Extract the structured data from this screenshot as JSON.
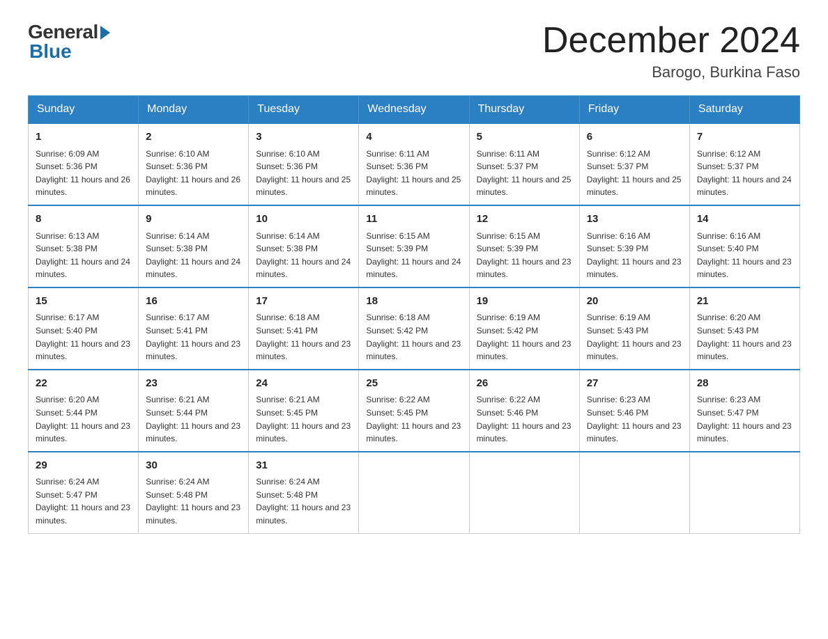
{
  "header": {
    "logo_general": "General",
    "logo_blue": "Blue",
    "title": "December 2024",
    "subtitle": "Barogo, Burkina Faso"
  },
  "days_of_week": [
    "Sunday",
    "Monday",
    "Tuesday",
    "Wednesday",
    "Thursday",
    "Friday",
    "Saturday"
  ],
  "weeks": [
    [
      {
        "day": "1",
        "sunrise": "6:09 AM",
        "sunset": "5:36 PM",
        "daylight": "11 hours and 26 minutes."
      },
      {
        "day": "2",
        "sunrise": "6:10 AM",
        "sunset": "5:36 PM",
        "daylight": "11 hours and 26 minutes."
      },
      {
        "day": "3",
        "sunrise": "6:10 AM",
        "sunset": "5:36 PM",
        "daylight": "11 hours and 25 minutes."
      },
      {
        "day": "4",
        "sunrise": "6:11 AM",
        "sunset": "5:36 PM",
        "daylight": "11 hours and 25 minutes."
      },
      {
        "day": "5",
        "sunrise": "6:11 AM",
        "sunset": "5:37 PM",
        "daylight": "11 hours and 25 minutes."
      },
      {
        "day": "6",
        "sunrise": "6:12 AM",
        "sunset": "5:37 PM",
        "daylight": "11 hours and 25 minutes."
      },
      {
        "day": "7",
        "sunrise": "6:12 AM",
        "sunset": "5:37 PM",
        "daylight": "11 hours and 24 minutes."
      }
    ],
    [
      {
        "day": "8",
        "sunrise": "6:13 AM",
        "sunset": "5:38 PM",
        "daylight": "11 hours and 24 minutes."
      },
      {
        "day": "9",
        "sunrise": "6:14 AM",
        "sunset": "5:38 PM",
        "daylight": "11 hours and 24 minutes."
      },
      {
        "day": "10",
        "sunrise": "6:14 AM",
        "sunset": "5:38 PM",
        "daylight": "11 hours and 24 minutes."
      },
      {
        "day": "11",
        "sunrise": "6:15 AM",
        "sunset": "5:39 PM",
        "daylight": "11 hours and 24 minutes."
      },
      {
        "day": "12",
        "sunrise": "6:15 AM",
        "sunset": "5:39 PM",
        "daylight": "11 hours and 23 minutes."
      },
      {
        "day": "13",
        "sunrise": "6:16 AM",
        "sunset": "5:39 PM",
        "daylight": "11 hours and 23 minutes."
      },
      {
        "day": "14",
        "sunrise": "6:16 AM",
        "sunset": "5:40 PM",
        "daylight": "11 hours and 23 minutes."
      }
    ],
    [
      {
        "day": "15",
        "sunrise": "6:17 AM",
        "sunset": "5:40 PM",
        "daylight": "11 hours and 23 minutes."
      },
      {
        "day": "16",
        "sunrise": "6:17 AM",
        "sunset": "5:41 PM",
        "daylight": "11 hours and 23 minutes."
      },
      {
        "day": "17",
        "sunrise": "6:18 AM",
        "sunset": "5:41 PM",
        "daylight": "11 hours and 23 minutes."
      },
      {
        "day": "18",
        "sunrise": "6:18 AM",
        "sunset": "5:42 PM",
        "daylight": "11 hours and 23 minutes."
      },
      {
        "day": "19",
        "sunrise": "6:19 AM",
        "sunset": "5:42 PM",
        "daylight": "11 hours and 23 minutes."
      },
      {
        "day": "20",
        "sunrise": "6:19 AM",
        "sunset": "5:43 PM",
        "daylight": "11 hours and 23 minutes."
      },
      {
        "day": "21",
        "sunrise": "6:20 AM",
        "sunset": "5:43 PM",
        "daylight": "11 hours and 23 minutes."
      }
    ],
    [
      {
        "day": "22",
        "sunrise": "6:20 AM",
        "sunset": "5:44 PM",
        "daylight": "11 hours and 23 minutes."
      },
      {
        "day": "23",
        "sunrise": "6:21 AM",
        "sunset": "5:44 PM",
        "daylight": "11 hours and 23 minutes."
      },
      {
        "day": "24",
        "sunrise": "6:21 AM",
        "sunset": "5:45 PM",
        "daylight": "11 hours and 23 minutes."
      },
      {
        "day": "25",
        "sunrise": "6:22 AM",
        "sunset": "5:45 PM",
        "daylight": "11 hours and 23 minutes."
      },
      {
        "day": "26",
        "sunrise": "6:22 AM",
        "sunset": "5:46 PM",
        "daylight": "11 hours and 23 minutes."
      },
      {
        "day": "27",
        "sunrise": "6:23 AM",
        "sunset": "5:46 PM",
        "daylight": "11 hours and 23 minutes."
      },
      {
        "day": "28",
        "sunrise": "6:23 AM",
        "sunset": "5:47 PM",
        "daylight": "11 hours and 23 minutes."
      }
    ],
    [
      {
        "day": "29",
        "sunrise": "6:24 AM",
        "sunset": "5:47 PM",
        "daylight": "11 hours and 23 minutes."
      },
      {
        "day": "30",
        "sunrise": "6:24 AM",
        "sunset": "5:48 PM",
        "daylight": "11 hours and 23 minutes."
      },
      {
        "day": "31",
        "sunrise": "6:24 AM",
        "sunset": "5:48 PM",
        "daylight": "11 hours and 23 minutes."
      },
      null,
      null,
      null,
      null
    ]
  ]
}
